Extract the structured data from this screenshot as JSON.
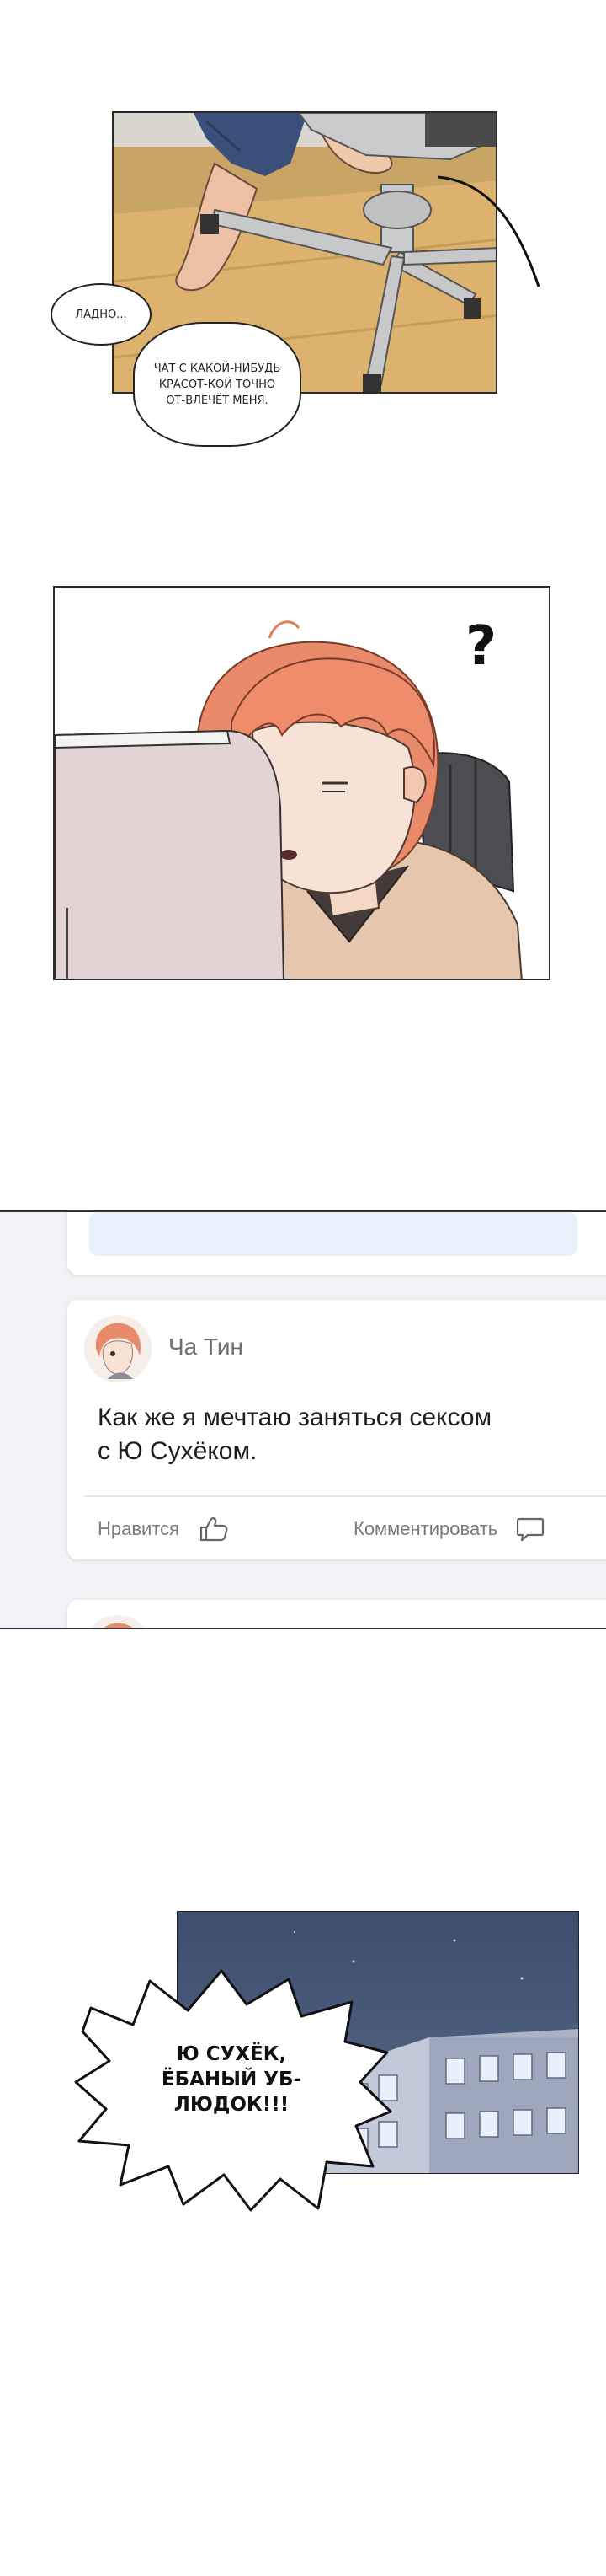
{
  "panel1": {
    "bubble_small": "ЛАДНО...",
    "bubble_large": "ЧАТ С КАКОЙ-НИБУДЬ КРАСОТ-КОЙ ТОЧНО ОТ-ВЛЕЧЁТ МЕНЯ."
  },
  "panel2": {
    "question_mark": "?"
  },
  "feed": {
    "post": {
      "author": "Ча Тин",
      "text_line1": "Как же я мечтаю заняться сексом",
      "text_line2": "с Ю Сухёком.",
      "like_label": "Нравится",
      "comment_label": "Комментировать"
    },
    "colors": {
      "background": "#f0f2f5",
      "placeholder": "#e9f3fc",
      "divider": "#e4e6e8"
    }
  },
  "panel4": {
    "shout_line1": "Ю СУХЁК,",
    "shout_line2": "ЁБАНЫЙ УБ-",
    "shout_line3": "ЛЮДОК!!!"
  },
  "icons": [
    "thumbs-up-icon",
    "comment-icon",
    "question-mark"
  ]
}
